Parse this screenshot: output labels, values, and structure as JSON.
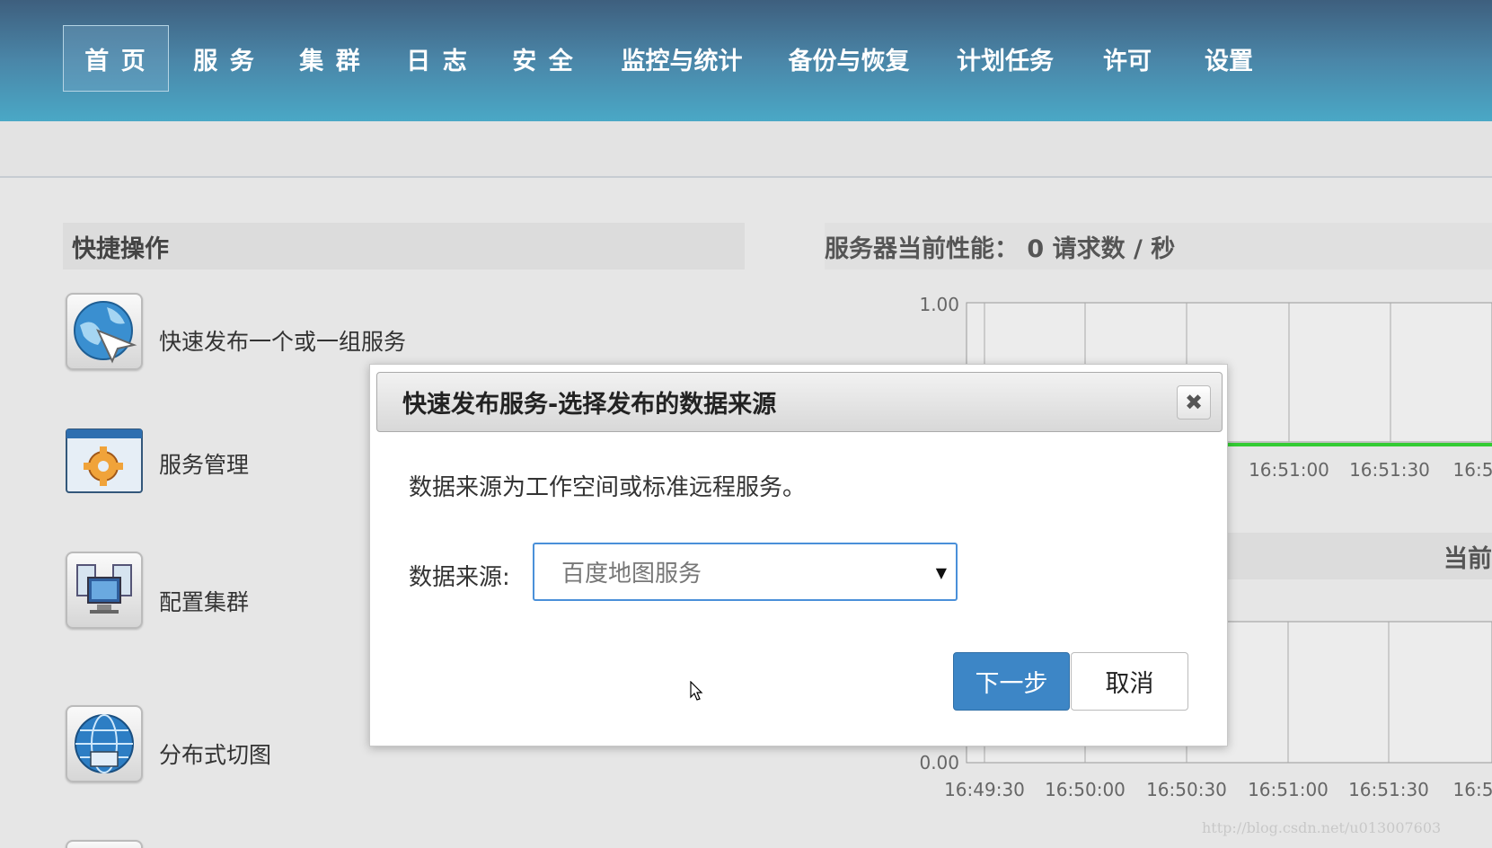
{
  "nav": {
    "items": [
      "首 页",
      "服 务",
      "集 群",
      "日 志",
      "安 全",
      "监控与统计",
      "备份与恢复",
      "计划任务",
      "许可",
      "设置"
    ],
    "active_index": 0
  },
  "quick_actions": {
    "title": "快捷操作",
    "items": [
      {
        "label": "快速发布一个或一组服务",
        "icon": "globe-arrow-icon"
      },
      {
        "label": "服务管理",
        "icon": "gear-window-icon"
      },
      {
        "label": "配置集群",
        "icon": "computers-icon"
      },
      {
        "label": "分布式切图",
        "icon": "globe-grid-icon"
      }
    ]
  },
  "performance": {
    "title": "服务器当前性能： 0 请求数 / 秒",
    "second_title_partial": "当前"
  },
  "chart_data": [
    {
      "type": "line",
      "title": "服务器当前性能： 0 请求数 / 秒",
      "ylim": [
        0,
        1
      ],
      "y_ticks": [
        "1.00"
      ],
      "x_ticks": [
        "16:51:00",
        "16:51:30",
        "16:5"
      ],
      "series": [
        {
          "values": [
            0,
            0,
            0
          ]
        }
      ],
      "line_color": "#33cc33",
      "grid": true
    },
    {
      "type": "line",
      "title": "当前",
      "ylim": [
        0,
        1
      ],
      "y_ticks": [
        "0.00"
      ],
      "x_ticks": [
        "16:49:30",
        "16:50:00",
        "16:50:30",
        "16:51:00",
        "16:51:30",
        "16:5"
      ],
      "grid": true
    }
  ],
  "dialog": {
    "title": "快速发布服务-选择发布的数据来源",
    "close_glyph": "✖",
    "description": "数据来源为工作空间或标准远程服务。",
    "source_label": "数据来源:",
    "source_value": "百度地图服务",
    "next_label": "下一步",
    "cancel_label": "取消"
  },
  "watermark": "http://blog.csdn.net/u013007603"
}
